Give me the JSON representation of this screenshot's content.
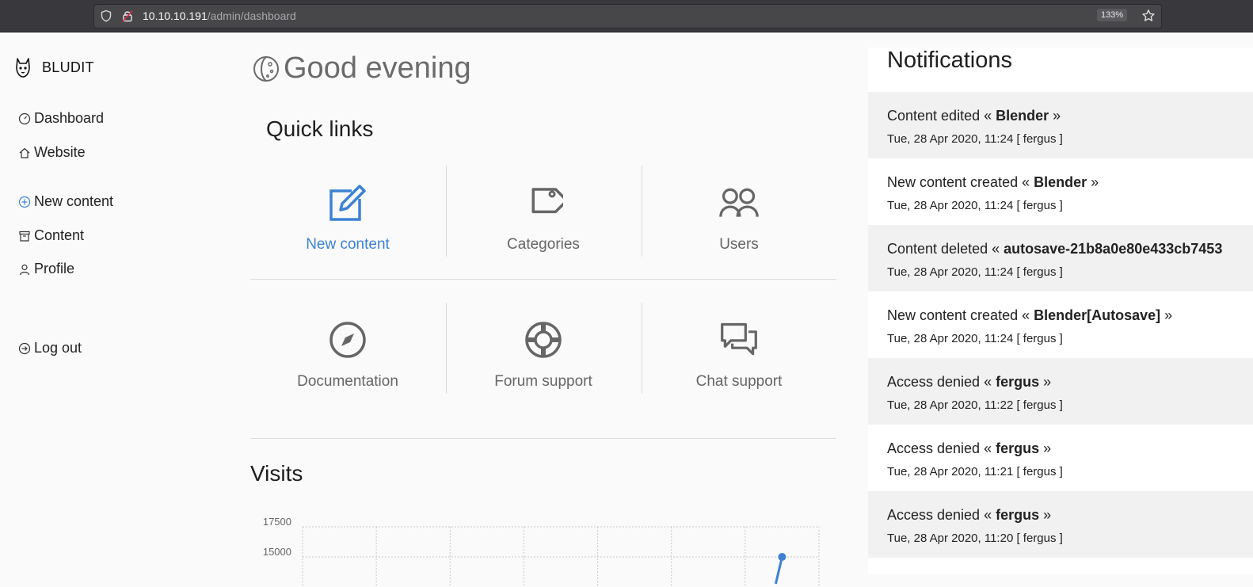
{
  "browser": {
    "url_host": "10.10.10.191",
    "url_path": "/admin/dashboard",
    "zoom": "133%"
  },
  "sidebar": {
    "brand": "BLUDIT",
    "items": [
      {
        "label": "Dashboard",
        "icon": "dashboard-icon"
      },
      {
        "label": "Website",
        "icon": "home-icon"
      },
      {
        "label": "New content",
        "icon": "plus-circle-icon"
      },
      {
        "label": "Content",
        "icon": "archive-icon"
      },
      {
        "label": "Profile",
        "icon": "user-icon"
      },
      {
        "label": "Log out",
        "icon": "logout-icon"
      }
    ]
  },
  "main": {
    "greeting": "Good evening",
    "quick_links_title": "Quick links",
    "quick_links": [
      {
        "label": "New content",
        "icon": "edit-icon"
      },
      {
        "label": "Categories",
        "icon": "tag-icon"
      },
      {
        "label": "Users",
        "icon": "users-icon"
      },
      {
        "label": "Documentation",
        "icon": "compass-icon"
      },
      {
        "label": "Forum support",
        "icon": "lifebuoy-icon"
      },
      {
        "label": "Chat support",
        "icon": "chat-icon"
      }
    ],
    "visits_title": "Visits"
  },
  "chart_data": {
    "type": "line",
    "title": "",
    "y_ticks": [
      15000,
      17500
    ],
    "series": [
      {
        "values": [
          null,
          null,
          null,
          null,
          null,
          null,
          15000
        ]
      }
    ],
    "grid": true,
    "color": "#3d82d3"
  },
  "notifications": {
    "title": "Notifications",
    "items": [
      {
        "prefix": "Content edited « ",
        "bold": "Blender",
        "suffix": " »",
        "date": "Tue, 28 Apr 2020, 11:24 [ fergus ]"
      },
      {
        "prefix": "New content created « ",
        "bold": "Blender",
        "suffix": " »",
        "date": "Tue, 28 Apr 2020, 11:24 [ fergus ]"
      },
      {
        "prefix": "Content deleted « ",
        "bold": "autosave-21b8a0e80e433cb7453",
        "suffix": "",
        "date": "Tue, 28 Apr 2020, 11:24 [ fergus ]"
      },
      {
        "prefix": "New content created « ",
        "bold": "Blender[Autosave]",
        "suffix": " »",
        "date": "Tue, 28 Apr 2020, 11:24 [ fergus ]"
      },
      {
        "prefix": "Access denied « ",
        "bold": "fergus",
        "suffix": " »",
        "date": "Tue, 28 Apr 2020, 11:22 [ fergus ]"
      },
      {
        "prefix": "Access denied « ",
        "bold": "fergus",
        "suffix": " »",
        "date": "Tue, 28 Apr 2020, 11:21 [ fergus ]"
      },
      {
        "prefix": "Access denied « ",
        "bold": "fergus",
        "suffix": " »",
        "date": "Tue, 28 Apr 2020, 11:20 [ fergus ]"
      }
    ]
  },
  "colors": {
    "accent": "#3d82d3",
    "browser_bar": "#38383d"
  }
}
